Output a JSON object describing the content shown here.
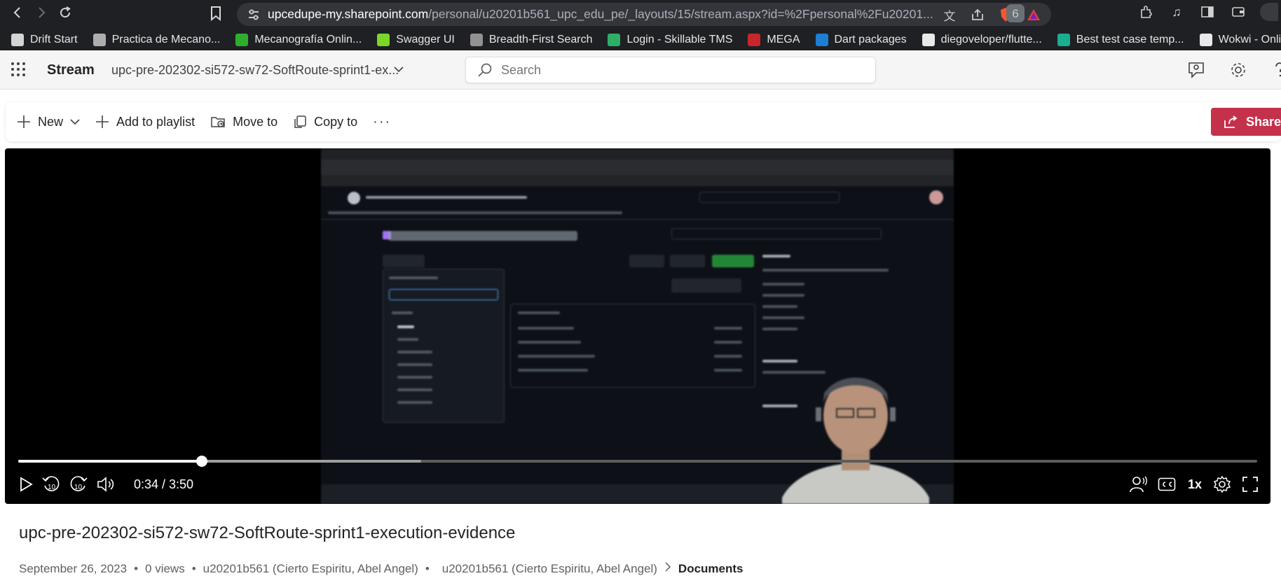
{
  "browser": {
    "url_host": "upcedupe-my.sharepoint.com",
    "url_path": "/personal/u20201b561_upc_edu_pe/_layouts/15/stream.aspx?id=%2Fpersonal%2Fu20201...",
    "brave_badge": "6",
    "bookmarks": [
      {
        "label": "Drift Start",
        "icon": "doc-icon",
        "color": "#e8e8e8"
      },
      {
        "label": "Practica de Mecano...",
        "icon": "keyboard-icon",
        "color": "#bdbdbd"
      },
      {
        "label": "Mecanografía Onlin...",
        "icon": "check-icon",
        "color": "#2fbf2f"
      },
      {
        "label": "Swagger UI",
        "icon": "swagger-icon",
        "color": "#85ea2d"
      },
      {
        "label": "Breadth-First Search",
        "icon": "globe-icon",
        "color": "#9e9e9e"
      },
      {
        "label": "Login - Skillable TMS",
        "icon": "skillable-icon",
        "color": "#2fbf6f"
      },
      {
        "label": "MEGA",
        "icon": "mega-icon",
        "color": "#d9272e"
      },
      {
        "label": "Dart packages",
        "icon": "dart-icon",
        "color": "#1e88e5"
      },
      {
        "label": "diegoveloper/flutte...",
        "icon": "github-icon",
        "color": "#ffffff"
      },
      {
        "label": "Best test case temp...",
        "icon": "euro-icon",
        "color": "#1abc9c"
      },
      {
        "label": "Wokwi - Online ESP...",
        "icon": "wokwi-icon",
        "color": "#ffffff"
      }
    ]
  },
  "header": {
    "app_name": "Stream",
    "file_title": "upc-pre-202302-si572-sw72-SoftRoute-sprint1-ex...",
    "search_placeholder": "Search"
  },
  "command_bar": {
    "new": "New",
    "add_to_playlist": "Add to playlist",
    "move_to": "Move to",
    "copy_to": "Copy to",
    "more": "···",
    "share": "Share"
  },
  "player": {
    "current_time": "0:34",
    "duration": "3:50",
    "time_display": "0:34 / 3:50",
    "played_fraction": 0.148,
    "buffered_fraction": 0.325,
    "skip_back_seconds": "10",
    "skip_forward_seconds": "10",
    "speed": "1x"
  },
  "video": {
    "title": "upc-pre-202302-si572-sw72-SoftRoute-sprint1-execution-evidence",
    "date": "September 26, 2023",
    "views": "0 views",
    "owner": "u20201b561 (Cierto Espiritu, Abel Angel)",
    "breadcrumb_owner": "u20201b561 (Cierto Espiritu, Abel Angel)",
    "breadcrumb_folder": "Documents"
  },
  "colors": {
    "share_button": "#c4314b",
    "browser_chrome": "#1f2023"
  }
}
